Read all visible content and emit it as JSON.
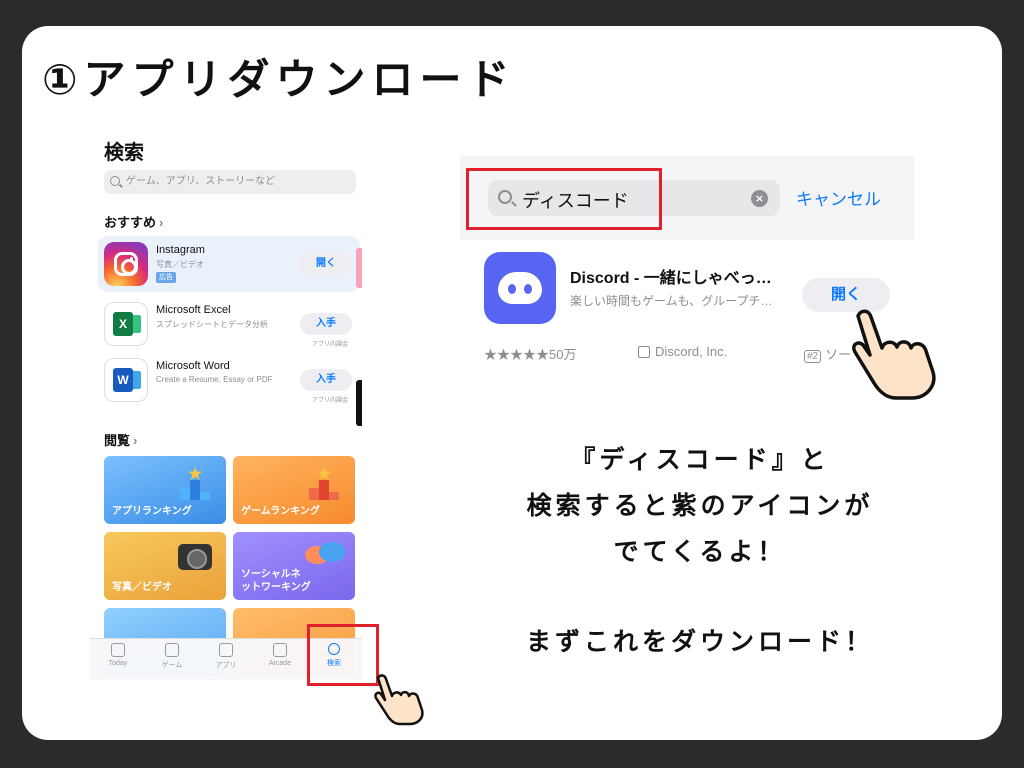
{
  "slide": {
    "title": "①アプリダウンロード"
  },
  "left_screen": {
    "title": "検索",
    "search_placeholder": "ゲーム、アプリ、ストーリーなど",
    "recommend_header": "おすすめ",
    "apps": [
      {
        "name": "Instagram",
        "subtitle": "写真／ビデオ",
        "badge": "広告",
        "button": "開く",
        "note": ""
      },
      {
        "name": "Microsoft Excel",
        "subtitle": "スプレッドシートとデータ分析",
        "badge": "",
        "button": "入手",
        "note": "アプリ内課金"
      },
      {
        "name": "Microsoft Word",
        "subtitle": "Create a Resume, Essay or PDF",
        "badge": "",
        "button": "入手",
        "note": "アプリ内課金"
      }
    ],
    "browse_header": "閲覧",
    "tiles": [
      {
        "label": "アプリランキング",
        "color": "#5aa8f0"
      },
      {
        "label": "ゲームランキング",
        "color": "#f7a047"
      },
      {
        "label": "写真／ビデオ",
        "color": "#f1b64b"
      },
      {
        "label1": "ソーシャルネ",
        "label2": "ットワーキング",
        "color": "#8b7ef2"
      }
    ],
    "tabs": [
      "Today",
      "ゲーム",
      "アプリ",
      "Arcade",
      "検索"
    ],
    "active_tab": "検索"
  },
  "right_screen": {
    "search_text": "ディスコード",
    "cancel_label": "キャンセル",
    "result": {
      "name": "Discord - 一緒にしゃべっ…",
      "subtitle": "楽しい時間もゲームも、グループチ…",
      "button": "開く",
      "rating": "★★★★★50万",
      "developer": "Discord, Inc.",
      "rank_badge": "#2",
      "rank_text": "ソー"
    }
  },
  "captions": {
    "line1": "『ディスコード』と",
    "line2": "検索すると紫のアイコンが",
    "line3": "でてくるよ！",
    "line4": "まずこれをダウンロード！"
  },
  "colors": {
    "highlight_red": "#e0202a",
    "ios_blue": "#0a7aff",
    "discord": "#5865f2",
    "background": "#2b2b2b"
  }
}
